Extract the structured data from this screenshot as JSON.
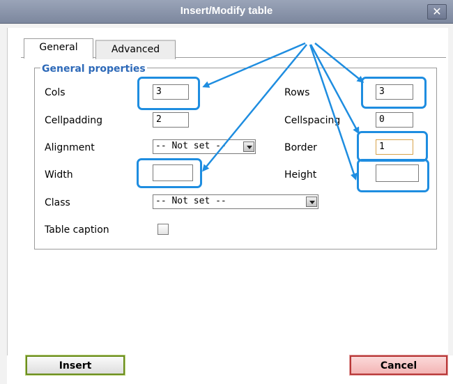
{
  "window": {
    "title": "Insert/Modify table",
    "close_glyph": "✕"
  },
  "tabs": [
    {
      "label": "General",
      "active": true
    },
    {
      "label": "Advanced",
      "active": false
    }
  ],
  "section": {
    "legend": "General properties"
  },
  "fields": {
    "cols": {
      "label": "Cols",
      "value": "3"
    },
    "rows": {
      "label": "Rows",
      "value": "3"
    },
    "cellpadding": {
      "label": "Cellpadding",
      "value": "2"
    },
    "cellspacing": {
      "label": "Cellspacing",
      "value": "0"
    },
    "alignment": {
      "label": "Alignment",
      "value": "-- Not set --"
    },
    "border": {
      "label": "Border",
      "value": "1"
    },
    "width": {
      "label": "Width",
      "value": ""
    },
    "height": {
      "label": "Height",
      "value": ""
    },
    "class": {
      "label": "Class",
      "value": "-- Not set --"
    },
    "caption": {
      "label": "Table caption",
      "checked": false
    }
  },
  "buttons": {
    "insert": "Insert",
    "cancel": "Cancel"
  },
  "colors": {
    "highlight": "#1e8de0",
    "legend": "#2d69b8",
    "titlebar": "#8590a8",
    "insert_border": "#6c8e1f",
    "cancel_border": "#b83838"
  }
}
